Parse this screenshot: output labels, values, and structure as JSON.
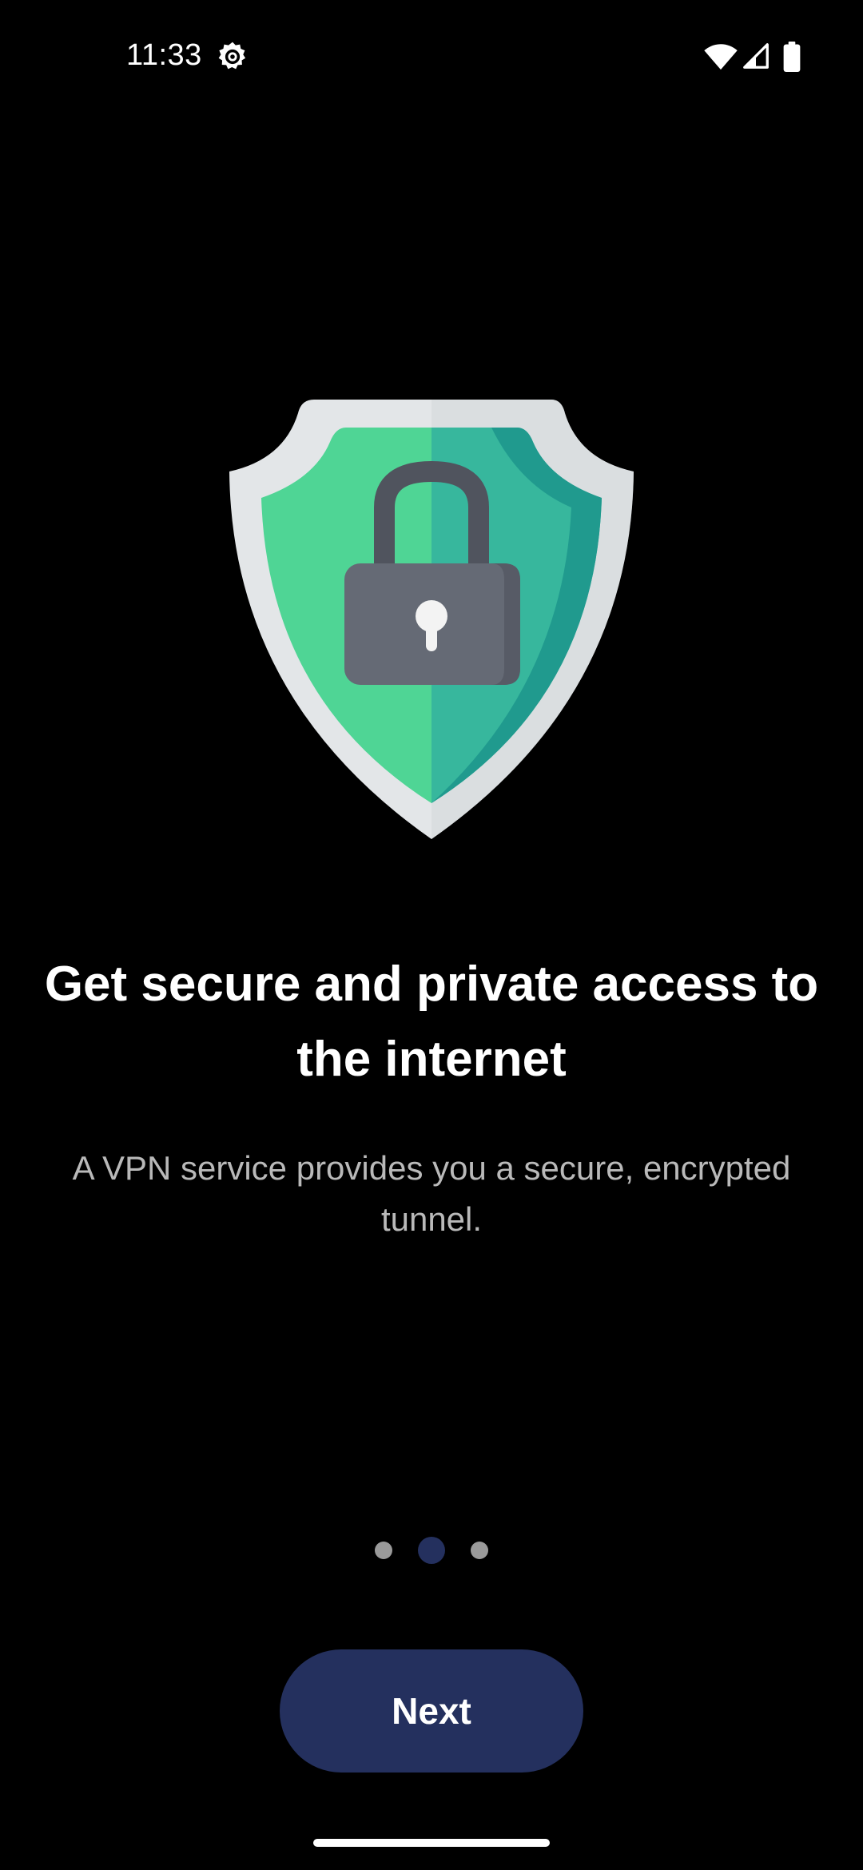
{
  "status_bar": {
    "time": "11:33",
    "icons": [
      "gear-icon",
      "wifi-icon",
      "signal-icon",
      "battery-icon"
    ]
  },
  "onboarding": {
    "illustration": "shield-lock-icon",
    "title": "Get secure and private access to the internet",
    "subtitle": "A VPN service provides you a secure, encrypted tunnel.",
    "page_count": 3,
    "current_page": 2
  },
  "actions": {
    "next_label": "Next"
  },
  "colors": {
    "background": "#000000",
    "accent": "#24305e",
    "shield_green": "#4fd595",
    "shield_teal": "#37b79d",
    "lock_gray": "#656a75",
    "dot_inactive": "#9a9a9a"
  }
}
